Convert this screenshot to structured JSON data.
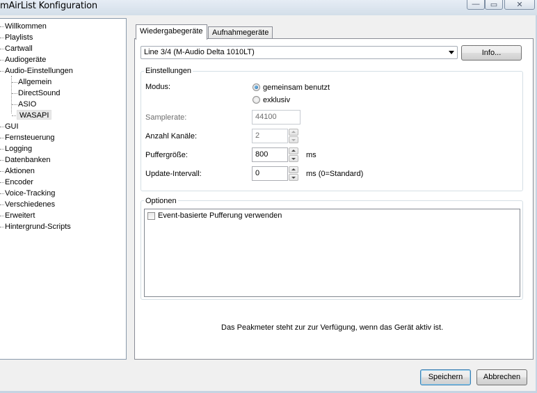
{
  "window": {
    "title": "mAirList Konfiguration",
    "minimize_glyph": "—",
    "maximize_glyph": "▭",
    "close_glyph": "✕"
  },
  "tree": {
    "items": [
      {
        "label": "Willkommen"
      },
      {
        "label": "Playlists"
      },
      {
        "label": "Cartwall"
      },
      {
        "label": "Audiogeräte"
      },
      {
        "label": "Audio-Einstellungen"
      },
      {
        "label": "Allgemein"
      },
      {
        "label": "DirectSound"
      },
      {
        "label": "ASIO"
      },
      {
        "label": "WASAPI"
      },
      {
        "label": "GUI"
      },
      {
        "label": "Fernsteuerung"
      },
      {
        "label": "Logging"
      },
      {
        "label": "Datenbanken"
      },
      {
        "label": "Aktionen"
      },
      {
        "label": "Encoder"
      },
      {
        "label": "Voice-Tracking"
      },
      {
        "label": "Verschiedenes"
      },
      {
        "label": "Erweitert"
      },
      {
        "label": "Hintergrund-Scripts"
      }
    ],
    "selected": "WASAPI"
  },
  "tabs": [
    {
      "label": "Wiedergabegeräte",
      "active": true
    },
    {
      "label": "Aufnahmegeräte",
      "active": false
    }
  ],
  "device": {
    "selected": "Line 3/4 (M-Audio Delta 1010LT)",
    "info_button": "Info..."
  },
  "settings": {
    "title": "Einstellungen",
    "mode_label": "Modus:",
    "mode_options": [
      "gemeinsam benutzt",
      "exklusiv"
    ],
    "mode_selected": "gemeinsam benutzt",
    "samplerate_label": "Samplerate:",
    "samplerate_value": "44100",
    "channels_label": "Anzahl Kanäle:",
    "channels_value": "2",
    "buffer_label": "Puffergröße:",
    "buffer_value": "800",
    "buffer_unit": "ms",
    "update_label": "Update-Intervall:",
    "update_value": "0",
    "update_unit": "ms (0=Standard)"
  },
  "options": {
    "title": "Optionen",
    "items": [
      {
        "label": "Event-basierte Pufferung verwenden",
        "checked": false
      }
    ]
  },
  "peakmeter_note": "Das Peakmeter steht zur zur Verfügung, wenn das Gerät aktiv ist.",
  "footer": {
    "save_label": "Speichern",
    "cancel_label": "Abbrechen"
  },
  "colors": {
    "accent": "#3c7fb1",
    "radio_fill": "#1c5e9e",
    "frame": "#c9d6e4"
  }
}
